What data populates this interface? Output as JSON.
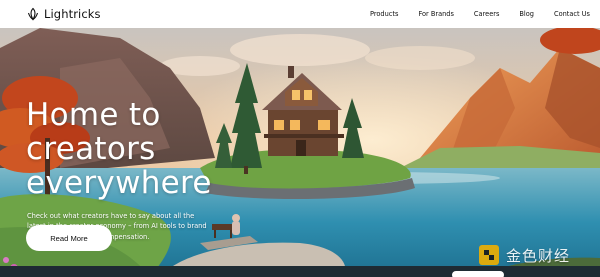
{
  "brand": {
    "name": "Lightricks",
    "logo_icon": "lightricks-logo-icon"
  },
  "nav": {
    "links": [
      "Products",
      "For Brands",
      "Careers",
      "Blog",
      "Contact Us"
    ]
  },
  "hero": {
    "title": "Home to creators everywhere",
    "description": "Check out what creators have to say about all the latest in the creator economy – from AI tools to brand deals, and even their compensation.",
    "cta_label": "Read More"
  },
  "watermark": {
    "text": "金色财经",
    "icon": "jinse-logo-icon"
  },
  "colors": {
    "nav_bg": "#ffffff",
    "sky_top": "#e9c9a9",
    "water": "#2f8fb0",
    "mountain": "#d8773f",
    "grass": "#7ab04a"
  }
}
